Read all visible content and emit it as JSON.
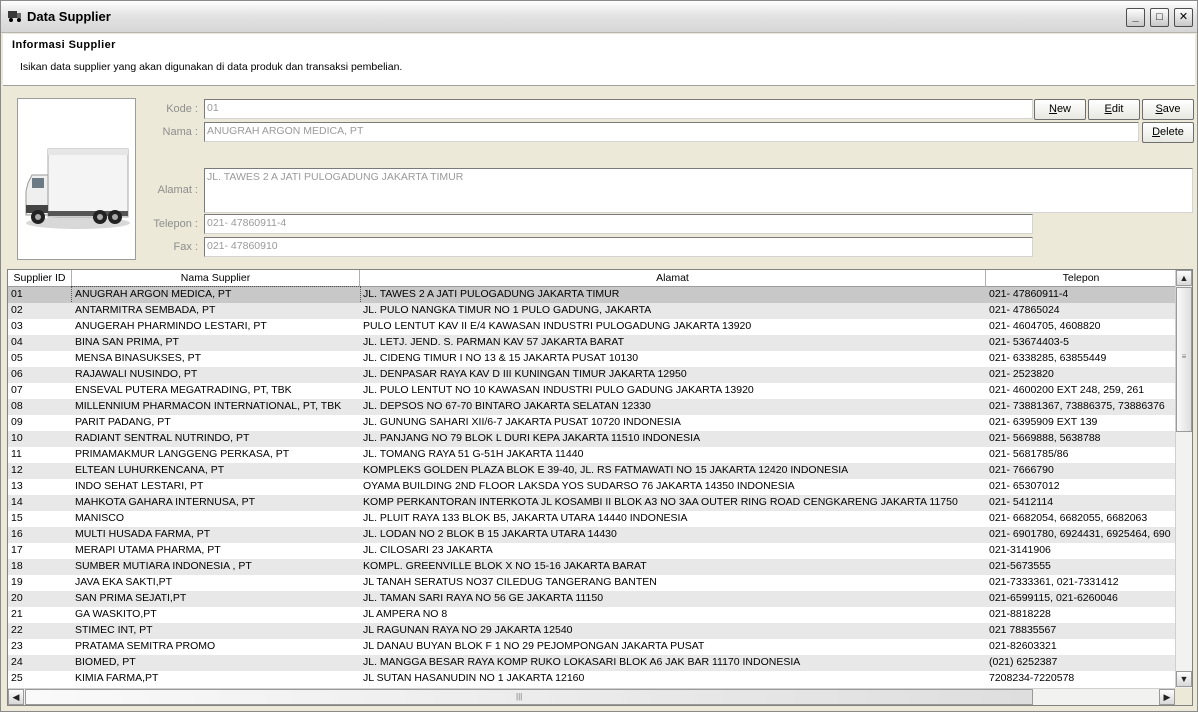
{
  "window": {
    "title": "Data Supplier",
    "minimize": "_",
    "maximize": "□",
    "close": "✕"
  },
  "header": {
    "title": "Informasi Supplier",
    "description": "Isikan data supplier yang akan digunakan di data produk dan transaksi pembelian."
  },
  "form": {
    "kode_label": "Kode :",
    "kode_value": "01",
    "nama_label": "Nama :",
    "nama_value": "ANUGRAH ARGON MEDICA, PT",
    "alamat_label": "Alamat :",
    "alamat_value": "JL. TAWES 2 A JATI PULOGADUNG JAKARTA TIMUR",
    "telepon_label": "Telepon :",
    "telepon_value": "021- 47860911-4",
    "fax_label": "Fax :",
    "fax_value": "021- 47860910"
  },
  "buttons": {
    "new_hot": "N",
    "new_rest": "ew",
    "edit_hot": "E",
    "edit_rest": "dit",
    "save_hot": "S",
    "save_rest": "ave",
    "delete_hot": "D",
    "delete_rest": "elete"
  },
  "grid": {
    "columns": [
      "Supplier ID",
      "Nama Supplier",
      "Alamat",
      "Telepon"
    ],
    "selected_index": 0,
    "rows": [
      [
        "01",
        "ANUGRAH ARGON MEDICA, PT",
        "JL. TAWES 2 A JATI PULOGADUNG JAKARTA TIMUR",
        "021- 47860911-4"
      ],
      [
        "02",
        "ANTARMITRA SEMBADA, PT",
        "JL. PULO NANGKA TIMUR NO 1 PULO GADUNG, JAKARTA",
        "021- 47865024"
      ],
      [
        "03",
        "ANUGERAH PHARMINDO LESTARI, PT",
        "PULO LENTUT KAV II E/4 KAWASAN INDUSTRI PULOGADUNG JAKARTA 13920",
        "021- 4604705, 4608820"
      ],
      [
        "04",
        "BINA SAN PRIMA, PT",
        "JL. LETJ. JEND. S. PARMAN KAV 57 JAKARTA BARAT",
        "021- 53674403-5"
      ],
      [
        "05",
        "MENSA BINASUKSES, PT",
        "JL. CIDENG TIMUR I NO 13 & 15 JAKARTA PUSAT 10130",
        "021- 6338285, 63855449"
      ],
      [
        "06",
        "RAJAWALI NUSINDO, PT",
        "JL. DENPASAR RAYA KAV D III KUNINGAN TIMUR JAKARTA 12950",
        "021- 2523820"
      ],
      [
        "07",
        "ENSEVAL PUTERA MEGATRADING, PT, TBK",
        "JL. PULO LENTUT  NO 10 KAWASAN INDUSTRI PULO GADUNG JAKARTA 13920",
        "021- 4600200 EXT 248, 259, 261"
      ],
      [
        "08",
        "MILLENNIUM PHARMACON INTERNATIONAL, PT, TBK",
        "JL. DEPSOS NO 67-70 BINTARO JAKARTA SELATAN 12330",
        "021- 73881367, 73886375, 73886376"
      ],
      [
        "09",
        "PARIT PADANG, PT",
        "JL. GUNUNG SAHARI XII/6-7 JAKARTA PUSAT 10720 INDONESIA",
        "021- 6395909 EXT 139"
      ],
      [
        "10",
        "RADIANT SENTRAL NUTRINDO, PT",
        "JL. PANJANG NO 79 BLOK L DURI KEPA JAKARTA 11510 INDONESIA",
        "021- 5669888, 5638788"
      ],
      [
        "11",
        "PRIMAMAKMUR LANGGENG PERKASA, PT",
        "JL. TOMANG RAYA 51 G-51H JAKARTA 11440",
        "021- 5681785/86"
      ],
      [
        "12",
        "ELTEAN LUHURKENCANA, PT",
        "KOMPLEKS GOLDEN PLAZA BLOK E 39-40,  JL. RS FATMAWATI NO 15 JAKARTA 12420 INDONESIA",
        "021- 7666790"
      ],
      [
        "13",
        "INDO SEHAT LESTARI, PT",
        "OYAMA BUILDING 2ND FLOOR LAKSDA YOS SUDARSO 76 JAKARTA 14350 INDONESIA",
        "021- 65307012"
      ],
      [
        "14",
        "MAHKOTA GAHARA INTERNUSA, PT",
        "KOMP PERKANTORAN INTERKOTA  JL KOSAMBI II BLOK A3 NO 3AA OUTER RING ROAD CENGKARENG JAKARTA 11750",
        "021- 5412114"
      ],
      [
        "15",
        "MANISCO",
        "JL. PLUIT RAYA 133 BLOK B5, JAKARTA UTARA 14440 INDONESIA",
        "021- 6682054, 6682055, 6682063"
      ],
      [
        "16",
        "MULTI HUSADA FARMA, PT",
        "JL. LODAN NO 2 BLOK B 15 JAKARTA UTARA 14430",
        "021- 6901780, 6924431, 6925464, 690"
      ],
      [
        "17",
        "MERAPI UTAMA PHARMA, PT",
        "JL. CILOSARI 23 JAKARTA",
        "021-3141906"
      ],
      [
        "18",
        "SUMBER MUTIARA INDONESIA , PT",
        "KOMPL. GREENVILLE BLOK X NO 15-16 JAKARTA BARAT",
        "021-5673555"
      ],
      [
        "19",
        "JAVA EKA SAKTI,PT",
        "JL TANAH SERATUS NO37 CILEDUG TANGERANG BANTEN",
        "021-7333361, 021-7331412"
      ],
      [
        "20",
        "SAN PRIMA SEJATI,PT",
        "JL. TAMAN SARI RAYA NO 56 GE JAKARTA 11150",
        "021-6599115, 021-6260046"
      ],
      [
        "21",
        "GA WASKITO,PT",
        "JL AMPERA NO 8",
        "021-8818228"
      ],
      [
        "22",
        "STIMEC INT, PT",
        "JL RAGUNAN RAYA NO 29 JAKARTA 12540",
        "021 78835567"
      ],
      [
        "23",
        "PRATAMA SEMITRA PROMO",
        "JL DANAU BUYAN BLOK F 1 NO 29 PEJOMPONGAN JAKARTA PUSAT",
        "021-82603321"
      ],
      [
        "24",
        "BIOMED, PT",
        "JL. MANGGA BESAR RAYA KOMP RUKO LOKASARI BLOK A6 JAK BAR 11170 INDONESIA",
        "(021) 6252387"
      ],
      [
        "25",
        "KIMIA FARMA,PT",
        "JL SUTAN HASANUDIN NO 1 JAKARTA 12160",
        "7208234-7220578"
      ]
    ]
  },
  "icons": {
    "app": "truck-icon",
    "supplier_image": "truck-image",
    "scroll_up": "▲",
    "scroll_down": "▼",
    "scroll_left": "◀",
    "scroll_right": "▶",
    "grip_v": "≡",
    "grip_h": "|||"
  }
}
